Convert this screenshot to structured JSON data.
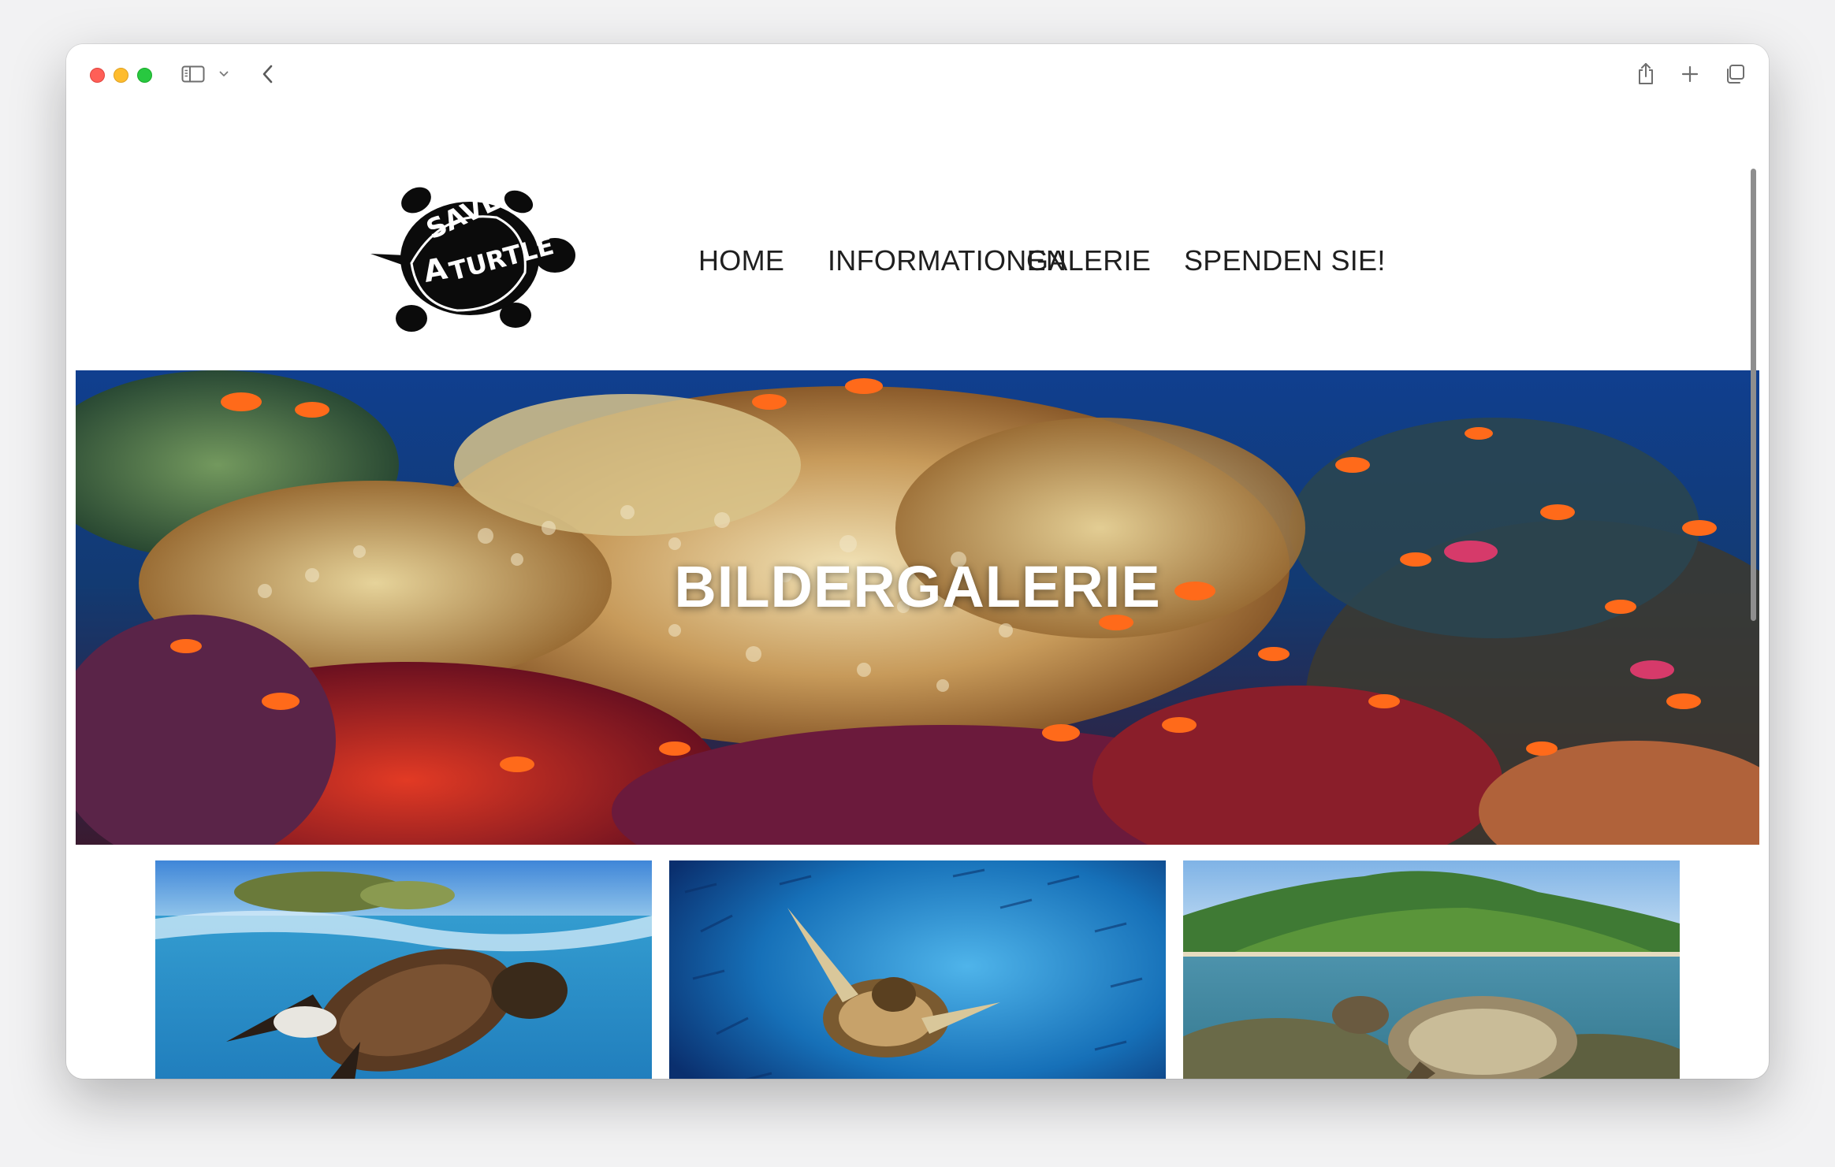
{
  "browser": {
    "icons": [
      "close-window",
      "minimize-window",
      "zoom-window",
      "sidebar-icon",
      "chevron-down-icon",
      "back-chevron-icon",
      "share-icon",
      "plus-icon",
      "tabs-overview-icon"
    ]
  },
  "site": {
    "logo_text": "SAVE A TURTLE",
    "nav": {
      "home": "HOME",
      "info": "INFORMATIONEN",
      "gallery": "GALERIE",
      "donate": "SPENDEN SIE!"
    },
    "hero": {
      "title": "BILDERGALERIE"
    },
    "gallery_images": [
      {
        "name": "turtle-at-surface"
      },
      {
        "name": "turtle-with-fish-school"
      },
      {
        "name": "turtle-near-island"
      }
    ]
  },
  "colors": {
    "nav_text": "#1f1f1f",
    "hero_title": "#ffffff",
    "traffic_red": "#ff5f57",
    "traffic_yellow": "#febc2e",
    "traffic_green": "#28c840"
  }
}
